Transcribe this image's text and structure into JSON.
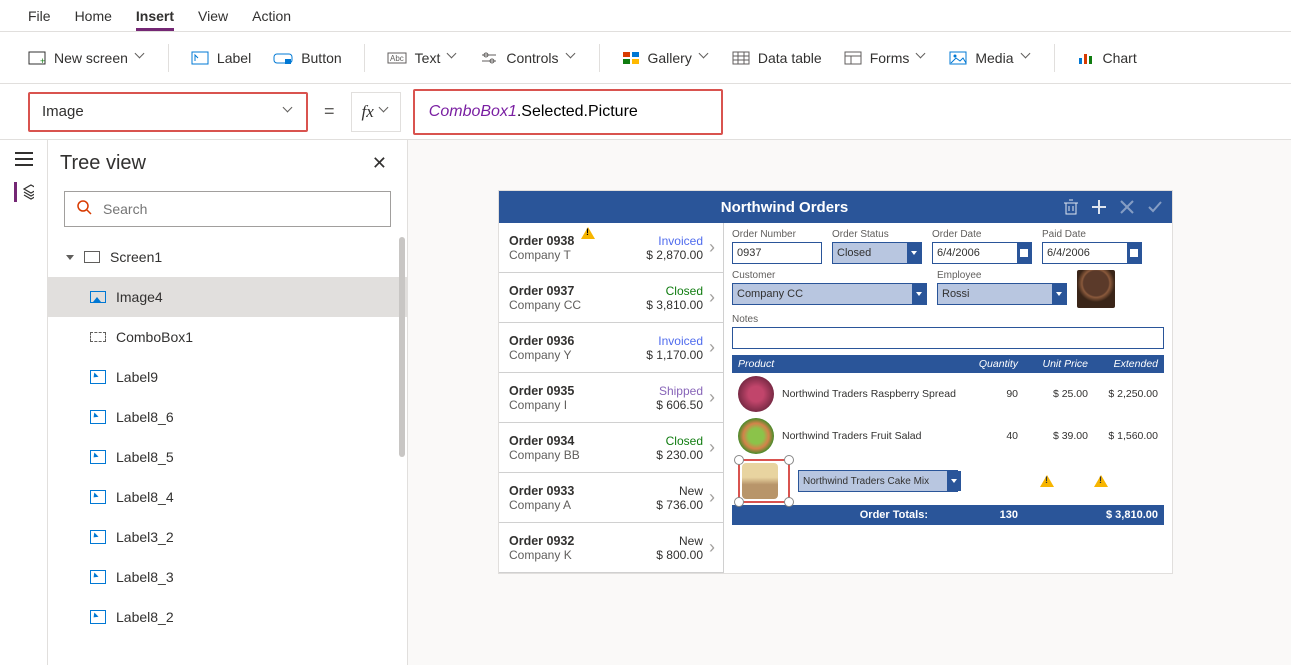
{
  "menu": {
    "file": "File",
    "home": "Home",
    "insert": "Insert",
    "view": "View",
    "action": "Action"
  },
  "ribbon": {
    "new_screen": "New screen",
    "label": "Label",
    "button": "Button",
    "text": "Text",
    "controls": "Controls",
    "gallery": "Gallery",
    "data_table": "Data table",
    "forms": "Forms",
    "media": "Media",
    "chart": "Chart"
  },
  "formula": {
    "property": "Image",
    "fx": "fx",
    "expr_hl": "ComboBox1",
    "expr_rest": ".Selected.Picture"
  },
  "tree": {
    "title": "Tree view",
    "search_placeholder": "Search",
    "screen": "Screen1",
    "items": [
      "Image4",
      "ComboBox1",
      "Label9",
      "Label8_6",
      "Label8_5",
      "Label8_4",
      "Label3_2",
      "Label8_3",
      "Label8_2"
    ]
  },
  "app": {
    "title": "Northwind Orders",
    "orders": [
      {
        "num": "Order 0938",
        "company": "Company T",
        "status": "Invoiced",
        "status_cls": "invoiced",
        "price": "$ 2,870.00",
        "warn": true
      },
      {
        "num": "Order 0937",
        "company": "Company CC",
        "status": "Closed",
        "status_cls": "closed",
        "price": "$ 3,810.00",
        "warn": false
      },
      {
        "num": "Order 0936",
        "company": "Company Y",
        "status": "Invoiced",
        "status_cls": "invoiced",
        "price": "$ 1,170.00",
        "warn": false
      },
      {
        "num": "Order 0935",
        "company": "Company I",
        "status": "Shipped",
        "status_cls": "shipped",
        "price": "$ 606.50",
        "warn": false
      },
      {
        "num": "Order 0934",
        "company": "Company BB",
        "status": "Closed",
        "status_cls": "closed",
        "price": "$ 230.00",
        "warn": false
      },
      {
        "num": "Order 0933",
        "company": "Company A",
        "status": "New",
        "status_cls": "new",
        "price": "$ 736.00",
        "warn": false
      },
      {
        "num": "Order 0932",
        "company": "Company K",
        "status": "New",
        "status_cls": "new",
        "price": "$ 800.00",
        "warn": false
      }
    ],
    "detail": {
      "labels": {
        "order_number": "Order Number",
        "order_status": "Order Status",
        "order_date": "Order Date",
        "paid_date": "Paid Date",
        "customer": "Customer",
        "employee": "Employee",
        "notes": "Notes"
      },
      "order_number": "0937",
      "order_status": "Closed",
      "order_date": "6/4/2006",
      "paid_date": "6/4/2006",
      "customer": "Company CC",
      "employee": "Rossi"
    },
    "products_header": {
      "product": "Product",
      "qty": "Quantity",
      "price": "Unit Price",
      "ext": "Extended"
    },
    "products": [
      {
        "name": "Northwind Traders Raspberry Spread",
        "qty": "90",
        "price": "$ 25.00",
        "ext": "$ 2,250.00",
        "thumb": ""
      },
      {
        "name": "Northwind Traders Fruit Salad",
        "qty": "40",
        "price": "$ 39.00",
        "ext": "$ 1,560.00",
        "thumb": "salad"
      }
    ],
    "new_product": "Northwind Traders Cake Mix",
    "totals": {
      "label": "Order Totals:",
      "qty": "130",
      "ext": "$ 3,810.00"
    }
  }
}
